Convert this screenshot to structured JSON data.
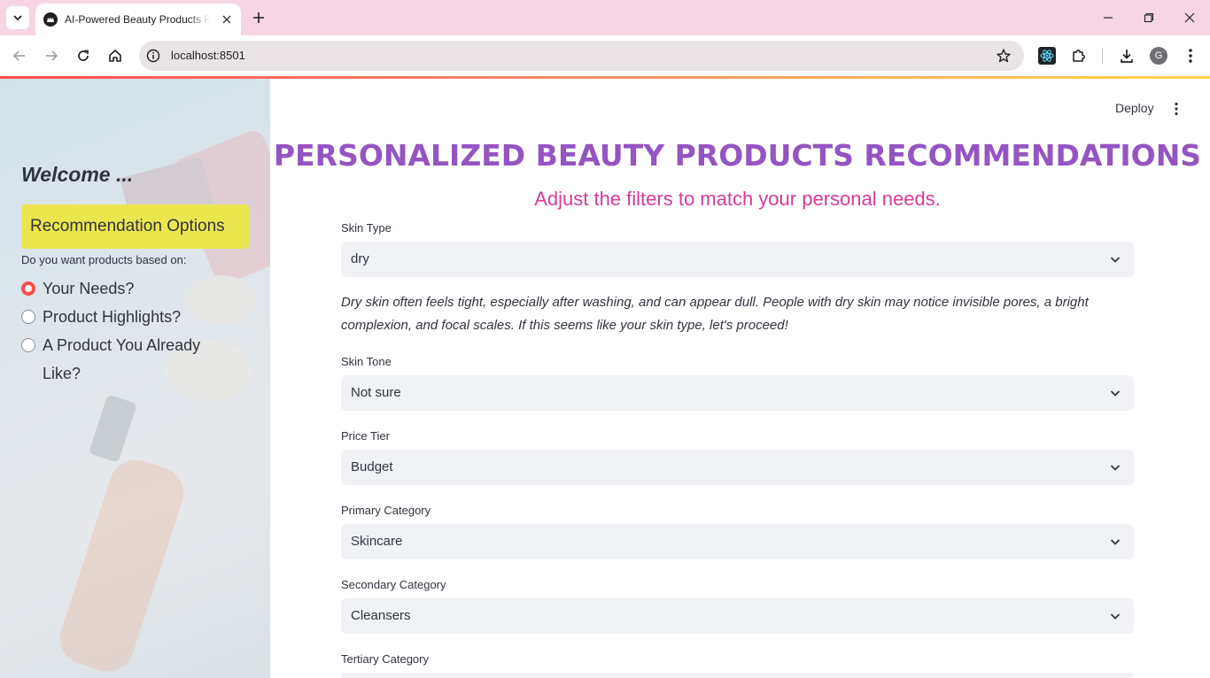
{
  "browser": {
    "tab_title": "AI-Powered Beauty Products Re",
    "url": "localhost:8501",
    "avatar_letter": "G"
  },
  "app": {
    "deploy_label": "Deploy",
    "title": "PERSONALIZED BEAUTY PRODUCTS RECOMMENDATIONS",
    "subtitle": "Adjust the filters to match your personal needs.",
    "title_color": "#9554c2",
    "subtitle_color": "#d43c97"
  },
  "sidebar": {
    "welcome": "Welcome ...",
    "options_header": "Recommendation Options",
    "radio_label": "Do you want products based on:",
    "options": [
      {
        "label": "Your Needs?",
        "selected": true
      },
      {
        "label": "Product Highlights?",
        "selected": false
      },
      {
        "label": "A Product You Already Like?",
        "selected": false
      }
    ],
    "accent": "#ff4b4b",
    "header_bg": "#ece64e"
  },
  "filters": {
    "skin_type": {
      "label": "Skin Type",
      "value": "dry"
    },
    "description": "Dry skin often feels tight, especially after washing, and can appear dull. People with dry skin may notice invisible pores, a bright complexion, and focal scales. If this seems like your skin type, let's proceed!",
    "skin_tone": {
      "label": "Skin Tone",
      "value": "Not sure"
    },
    "price_tier": {
      "label": "Price Tier",
      "value": "Budget"
    },
    "primary_category": {
      "label": "Primary Category",
      "value": "Skincare"
    },
    "secondary_category": {
      "label": "Secondary Category",
      "value": "Cleansers"
    },
    "tertiary_category": {
      "label": "Tertiary Category",
      "value": ""
    }
  }
}
